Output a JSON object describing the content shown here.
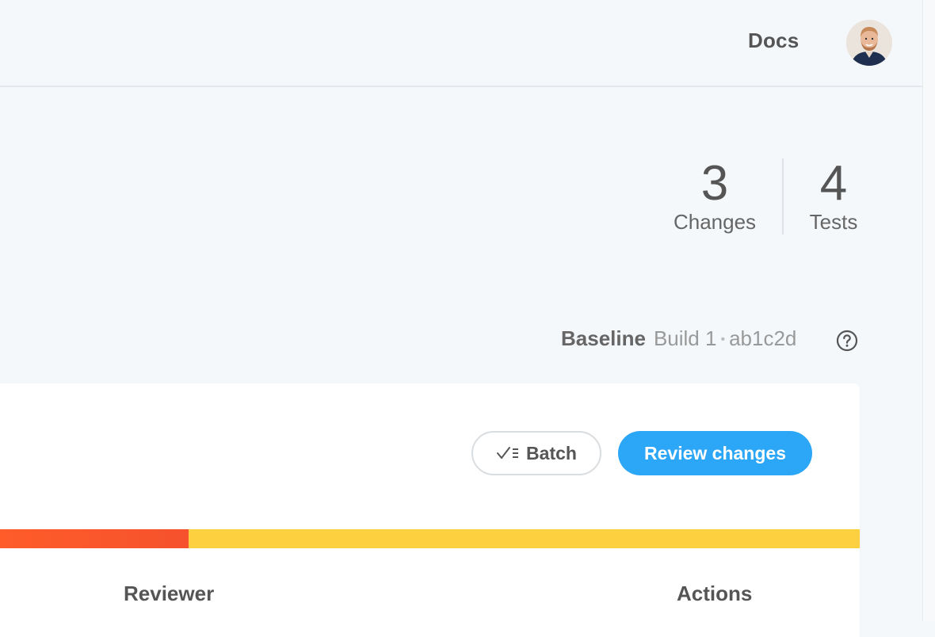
{
  "header": {
    "docs_label": "Docs",
    "avatar_icon": "user-avatar"
  },
  "stats": {
    "changes": {
      "value": "3",
      "label": "Changes"
    },
    "tests": {
      "value": "4",
      "label": "Tests"
    }
  },
  "baseline": {
    "label": "Baseline",
    "build": "Build 1",
    "separator": "•",
    "commit": "ab1c2d",
    "help_icon": "question-circle-icon"
  },
  "toolbar": {
    "batch_label": "Batch",
    "batch_icon": "checklist-icon",
    "review_label": "Review changes"
  },
  "colors": {
    "accent": "#2ca6f6",
    "progress_red": "#f5522d",
    "progress_yellow": "#fdd03f"
  },
  "progress": {
    "segments": [
      {
        "status": "denied",
        "fraction": 0.22
      },
      {
        "status": "pending",
        "fraction": 0.78
      }
    ]
  },
  "table": {
    "columns": [
      "Reviewer",
      "Actions"
    ]
  }
}
